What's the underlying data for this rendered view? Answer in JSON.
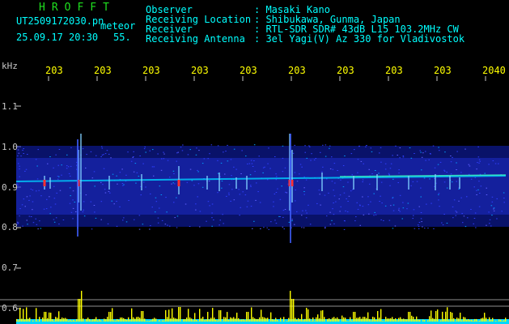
{
  "header": {
    "app_title": "HROFFT",
    "filename": "UT2509172030.pn",
    "meteor_label": "meteor",
    "datetime": "25.09.17 20:30",
    "count": "55.",
    "info_rows": [
      {
        "label": "Observer",
        "value": ": Masaki Kano"
      },
      {
        "label": "Receiving Location",
        "value": ": Shibukawa, Gunma, Japan"
      },
      {
        "label": "Receiver",
        "value": ": RTL-SDR SDR# 43dB L15 103.2MHz CW"
      },
      {
        "label": "Receiving Antenna",
        "value": ": 3el Yagi(V) Az 330 for Vladivostok"
      }
    ]
  },
  "axis": {
    "unit": "kHz",
    "y_ticks": [
      "1.1",
      "1.0",
      "0.9",
      "0.8",
      "0.7",
      "0.6"
    ],
    "x_ticks": [
      "203",
      "203",
      "203",
      "203",
      "203",
      "203",
      "203",
      "203",
      "203",
      "2040"
    ]
  },
  "colors": {
    "background": "#000000",
    "header_text": "#00ffff",
    "tick_text": "#ffff00",
    "title_text": "#1fe01f",
    "signal_band": "#1020c0",
    "echo": "#ff3030",
    "histogram": "#ffff00",
    "histogram_base": "#00d8ff"
  }
}
